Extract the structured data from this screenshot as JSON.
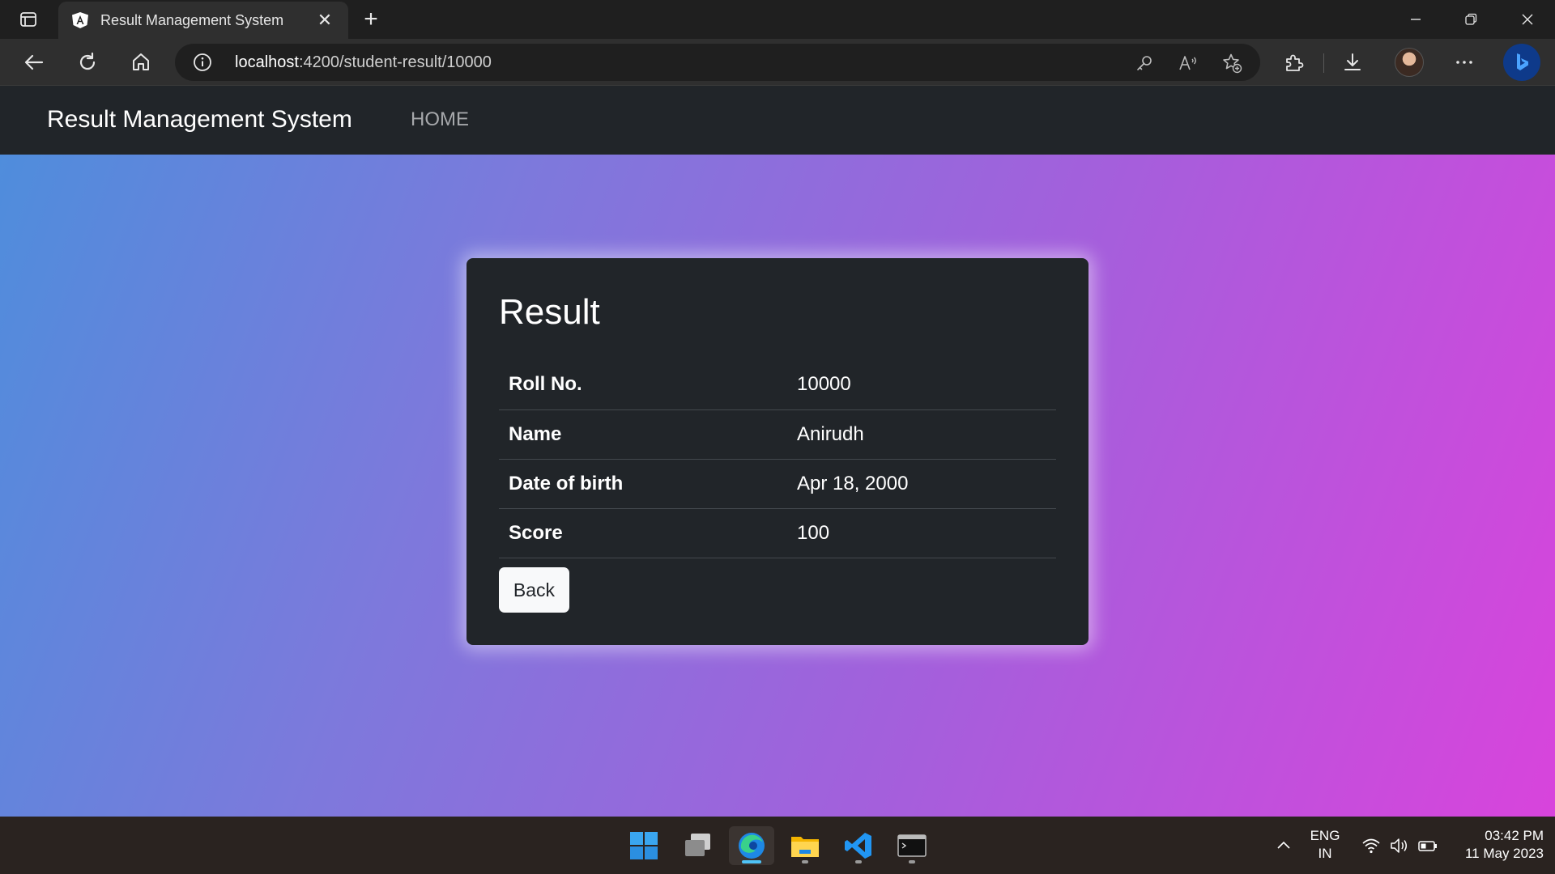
{
  "browser": {
    "tab_title": "Result Management System",
    "url_host": "localhost",
    "url_path": ":4200/student-result/10000"
  },
  "navbar": {
    "brand": "Result Management System",
    "home_link": "HOME"
  },
  "result_card": {
    "heading": "Result",
    "rows": [
      {
        "label": "Roll No.",
        "value": "10000"
      },
      {
        "label": "Name",
        "value": "Anirudh"
      },
      {
        "label": "Date of birth",
        "value": "Apr 18, 2000"
      },
      {
        "label": "Score",
        "value": "100"
      }
    ],
    "back_label": "Back"
  },
  "taskbar": {
    "lang_line1": "ENG",
    "lang_line2": "IN",
    "time": "03:42 PM",
    "date": "11 May 2023"
  },
  "colors": {
    "navbar_bg": "#212529",
    "card_bg": "#212529",
    "gradient_start": "#4f8ddc",
    "gradient_end": "#d844dc"
  }
}
